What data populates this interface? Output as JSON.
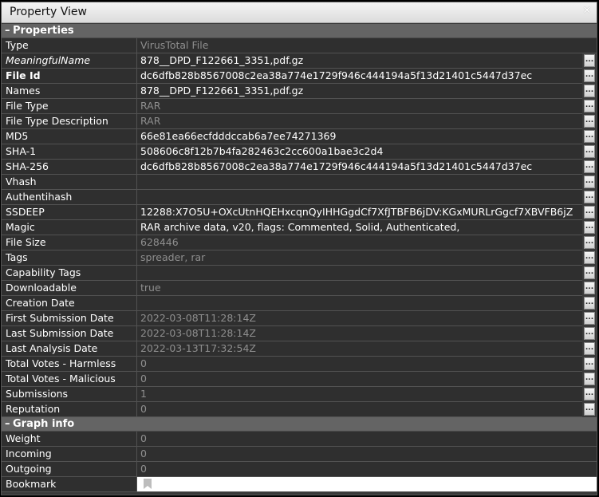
{
  "window": {
    "title": "Property View",
    "close": "✕"
  },
  "sections": {
    "properties": "Properties",
    "graph": "Graph info"
  },
  "properties": [
    {
      "name": "Type",
      "value": "VirusTotal File",
      "style": "normal",
      "editable": false,
      "button": false
    },
    {
      "name": "MeaningfulName",
      "value": "878__DPD_F122661_3351,pdf.gz",
      "style": "italic",
      "editable": true,
      "button": true
    },
    {
      "name": "File Id",
      "value": "dc6dfb828b8567008c2ea38a774e1729f946c444194a5f13d21401c5447d37ec",
      "style": "bold",
      "editable": true,
      "button": true
    },
    {
      "name": "Names",
      "value": "878__DPD_F122661_3351,pdf.gz",
      "style": "normal",
      "editable": true,
      "button": true
    },
    {
      "name": "File Type",
      "value": "RAR",
      "style": "normal",
      "editable": false,
      "button": true
    },
    {
      "name": "File Type Description",
      "value": "RAR",
      "style": "normal",
      "editable": false,
      "button": true
    },
    {
      "name": "MD5",
      "value": "66e81ea66ecfdddccab6a7ee74271369",
      "style": "normal",
      "editable": true,
      "button": true
    },
    {
      "name": "SHA-1",
      "value": "508606c8f12b7b4fa282463c2cc600a1bae3c2d4",
      "style": "normal",
      "editable": true,
      "button": true
    },
    {
      "name": "SHA-256",
      "value": "dc6dfb828b8567008c2ea38a774e1729f946c444194a5f13d21401c5447d37ec",
      "style": "normal",
      "editable": true,
      "button": true
    },
    {
      "name": "Vhash",
      "value": "",
      "style": "normal",
      "editable": true,
      "button": true
    },
    {
      "name": "Authentihash",
      "value": "",
      "style": "normal",
      "editable": true,
      "button": true
    },
    {
      "name": "SSDEEP",
      "value": "12288:X7O5U+OXcUtnHQEHxcqnQyIHHGgdCf7XfJTBFB6jDV:KGxMURLrGgcf7XBVFB6jZ",
      "style": "normal",
      "editable": true,
      "button": true
    },
    {
      "name": "Magic",
      "value": "RAR archive data, v20, flags: Commented, Solid, Authenticated,",
      "style": "normal",
      "editable": true,
      "button": true
    },
    {
      "name": "File Size",
      "value": "628446",
      "style": "normal",
      "editable": false,
      "button": true
    },
    {
      "name": "Tags",
      "value": "spreader, rar",
      "style": "normal",
      "editable": false,
      "button": true
    },
    {
      "name": "Capability Tags",
      "value": "",
      "style": "normal",
      "editable": false,
      "button": true
    },
    {
      "name": "Downloadable",
      "value": "true",
      "style": "normal",
      "editable": false,
      "button": true
    },
    {
      "name": "Creation Date",
      "value": "",
      "style": "normal",
      "editable": false,
      "button": true
    },
    {
      "name": "First Submission Date",
      "value": "2022-03-08T11:28:14Z",
      "style": "normal",
      "editable": false,
      "button": true
    },
    {
      "name": "Last Submission Date",
      "value": "2022-03-08T11:28:14Z",
      "style": "normal",
      "editable": false,
      "button": true
    },
    {
      "name": "Last Analysis Date",
      "value": "2022-03-13T17:32:54Z",
      "style": "normal",
      "editable": false,
      "button": true
    },
    {
      "name": "Total Votes - Harmless",
      "value": "0",
      "style": "normal",
      "editable": false,
      "button": true
    },
    {
      "name": "Total Votes - Malicious",
      "value": "0",
      "style": "normal",
      "editable": false,
      "button": true
    },
    {
      "name": "Submissions",
      "value": "1",
      "style": "normal",
      "editable": false,
      "button": true
    },
    {
      "name": "Reputation",
      "value": "0",
      "style": "normal",
      "editable": false,
      "button": true
    }
  ],
  "graph": [
    {
      "name": "Weight",
      "value": "0"
    },
    {
      "name": "Incoming",
      "value": "0"
    },
    {
      "name": "Outgoing",
      "value": "0"
    }
  ],
  "bookmark": {
    "name": "Bookmark",
    "icon": "bookmark-icon"
  },
  "button_label": "...",
  "colors": {
    "background": "#3a3a3a",
    "section_header": "#646464",
    "readonly_text": "#8e8e8e",
    "editable_text": "#ffffff"
  }
}
